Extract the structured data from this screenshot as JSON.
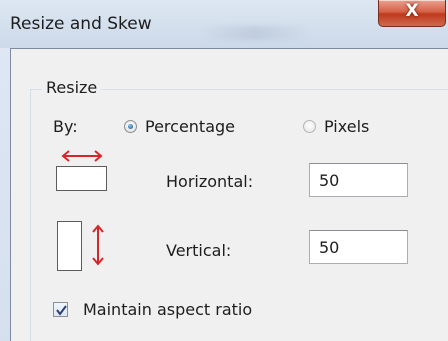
{
  "window": {
    "title": "Resize and Skew",
    "close_glyph": "X"
  },
  "resize": {
    "group_title": "Resize",
    "by_label": "By:",
    "options": [
      {
        "label": "Percentage",
        "selected": true
      },
      {
        "label": "Pixels",
        "selected": false
      }
    ],
    "horizontal": {
      "label": "Horizontal:",
      "value": "50"
    },
    "vertical": {
      "label": "Vertical:",
      "value": "50"
    },
    "maintain_aspect": {
      "label": "Maintain aspect ratio",
      "checked": true
    }
  },
  "colors": {
    "arrow": "#d8252a",
    "radio_dot": "#1c5fa3",
    "close_button": "#c9442a"
  },
  "icons": [
    "close-icon",
    "horizontal-resize-arrow-icon",
    "vertical-resize-arrow-icon",
    "checkmark-icon"
  ]
}
